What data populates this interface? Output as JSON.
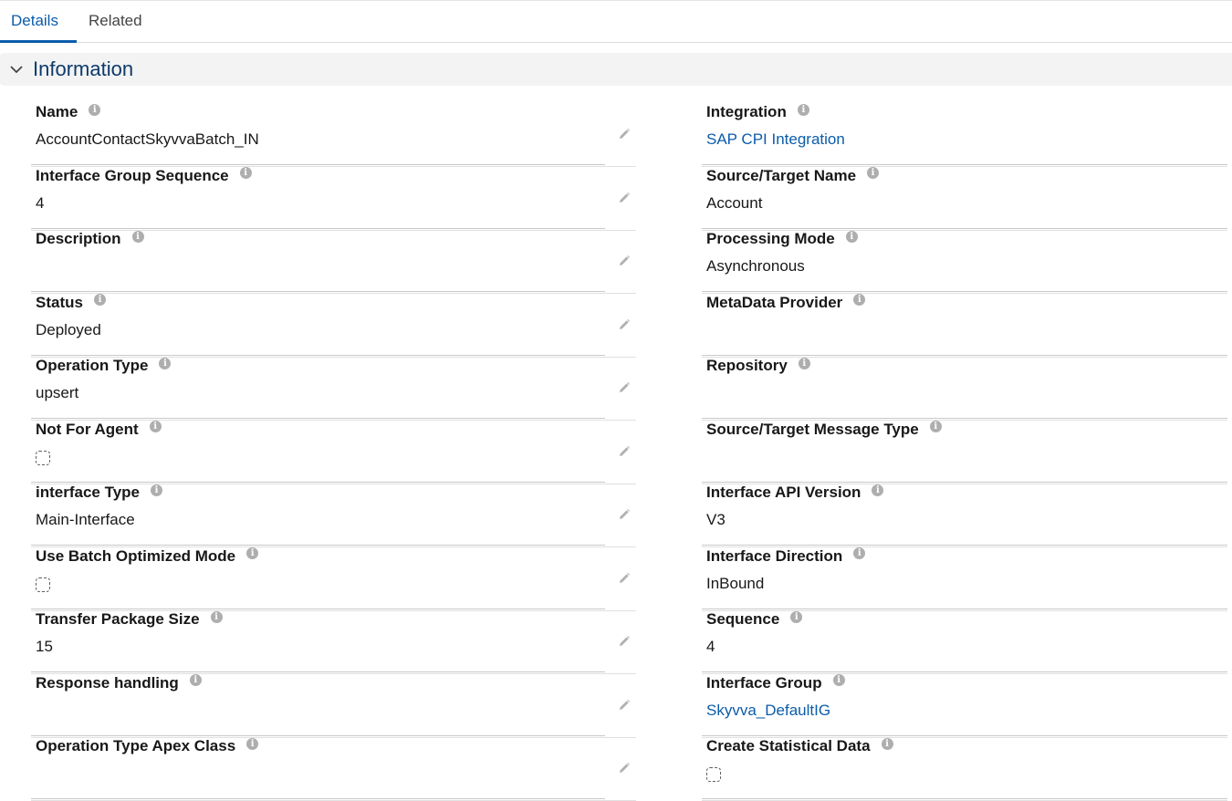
{
  "tabs": [
    {
      "label": "Details",
      "active": true
    },
    {
      "label": "Related",
      "active": false
    }
  ],
  "section": {
    "title": "Information"
  },
  "left_fields": [
    {
      "label": "Name",
      "value": "AccountContactSkyvvaBatch_IN"
    },
    {
      "label": "Interface Group Sequence",
      "value": "4"
    },
    {
      "label": "Description",
      "value": ""
    },
    {
      "label": "Status",
      "value": "Deployed"
    },
    {
      "label": "Operation Type",
      "value": "upsert"
    },
    {
      "label": "Not For Agent",
      "value": "",
      "checkbox": true
    },
    {
      "label": "interface Type",
      "value": "Main-Interface"
    },
    {
      "label": "Use Batch Optimized Mode",
      "value": "",
      "checkbox": true
    },
    {
      "label": "Transfer Package Size",
      "value": "15"
    },
    {
      "label": "Response handling",
      "value": ""
    },
    {
      "label": "Operation Type Apex Class",
      "value": ""
    }
  ],
  "right_fields": [
    {
      "label": "Integration",
      "value": "SAP CPI Integration",
      "link": true
    },
    {
      "label": "Source/Target Name",
      "value": "Account"
    },
    {
      "label": "Processing Mode",
      "value": "Asynchronous"
    },
    {
      "label": "MetaData Provider",
      "value": ""
    },
    {
      "label": "Repository",
      "value": ""
    },
    {
      "label": "Source/Target Message Type",
      "value": ""
    },
    {
      "label": "Interface API Version",
      "value": "V3"
    },
    {
      "label": "Interface Direction",
      "value": "InBound"
    },
    {
      "label": "Sequence",
      "value": "4"
    },
    {
      "label": "Interface Group",
      "value": "Skyvva_DefaultIG",
      "link": true
    },
    {
      "label": "Create Statistical Data",
      "value": "",
      "checkbox": true
    }
  ],
  "icons": {
    "info": "info-icon",
    "edit": "pencil-icon",
    "collapse": "chevron-down-icon"
  },
  "colors": {
    "accent": "#0b5cab",
    "section_title": "#0d3a6b",
    "section_bg": "#f3f3f3"
  }
}
